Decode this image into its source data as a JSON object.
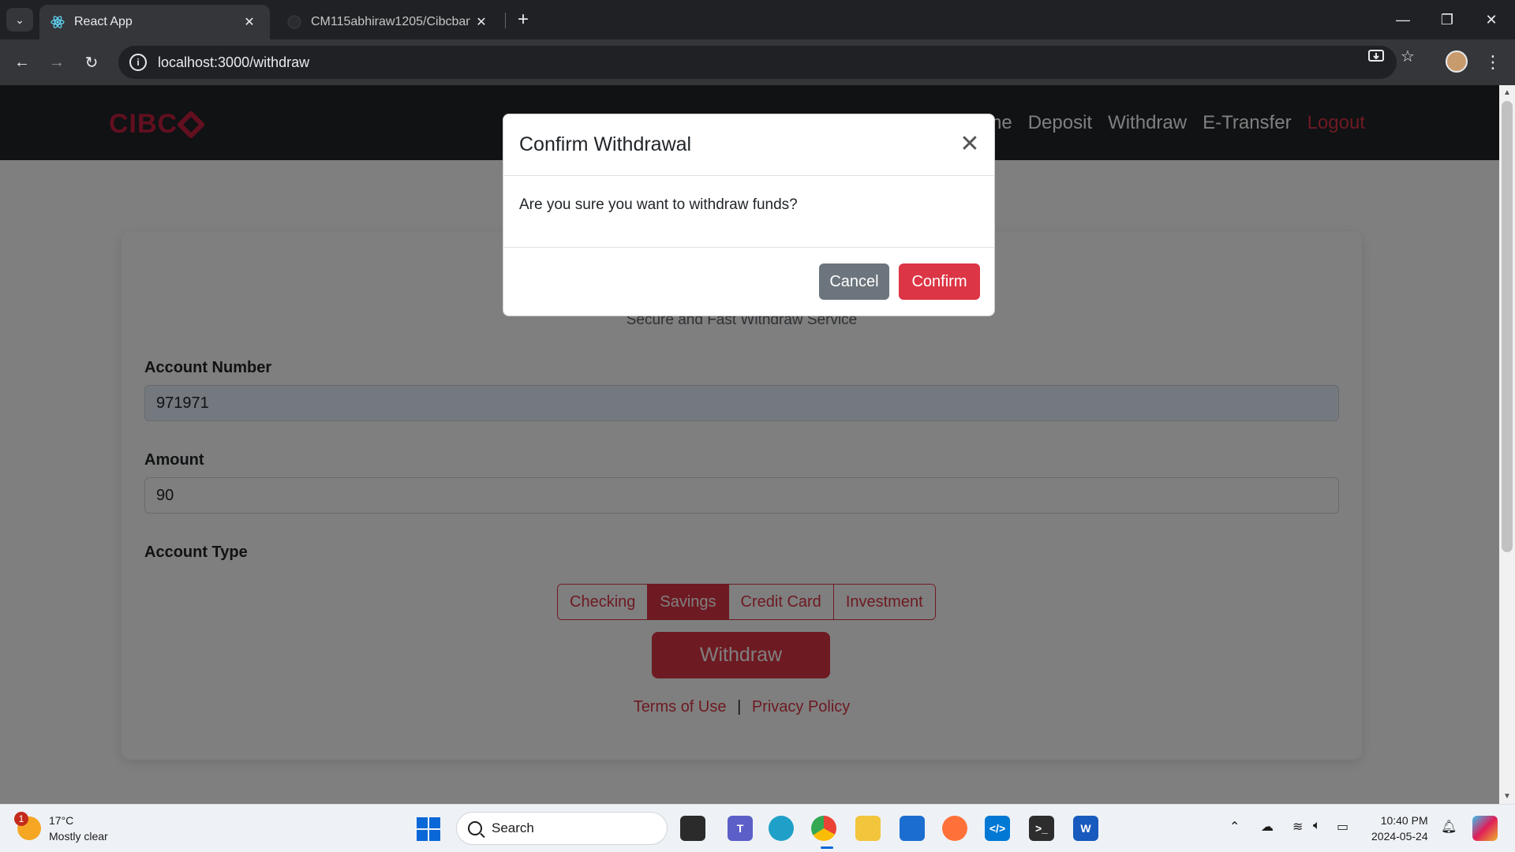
{
  "browser": {
    "tabs": [
      {
        "title": "React App",
        "active": true
      },
      {
        "title": "CM115abhiraw1205/Cibcbank",
        "active": false
      }
    ],
    "address": "localhost:3000/withdraw"
  },
  "site": {
    "logo_text": "CIBC",
    "nav": {
      "home": "ome",
      "deposit": "Deposit",
      "withdraw": "Withdraw",
      "etransfer": "E-Transfer",
      "logout": "Logout"
    }
  },
  "form": {
    "subtitle": "Secure and Fast Withdraw Service",
    "account_number_label": "Account Number",
    "account_number_value": "971971",
    "amount_label": "Amount",
    "amount_value": "90",
    "account_type_label": "Account Type",
    "account_types": [
      "Checking",
      "Savings",
      "Credit Card",
      "Investment"
    ],
    "selected_account_type": "Savings",
    "submit_label": "Withdraw",
    "terms_link": "Terms of Use",
    "separator": "|",
    "privacy_link": "Privacy Policy"
  },
  "modal": {
    "title": "Confirm Withdrawal",
    "body": "Are you sure you want to withdraw funds?",
    "cancel_label": "Cancel",
    "confirm_label": "Confirm"
  },
  "taskbar": {
    "weather_temp": "17°C",
    "weather_desc": "Mostly clear",
    "weather_badge": "1",
    "search_label": "Search",
    "time": "10:40 PM",
    "date": "2024-05-24"
  },
  "colors": {
    "brand_red": "#dc3545",
    "nav_bg": "#212529",
    "cancel_gray": "#6c757d"
  }
}
